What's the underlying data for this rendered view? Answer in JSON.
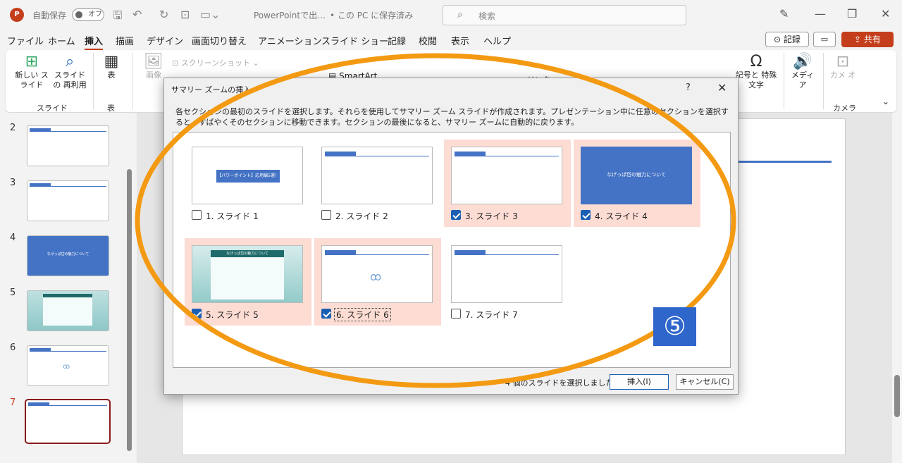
{
  "titlebar": {
    "autosave_label": "自動保存",
    "autosave_state": "オフ",
    "doc_title": "PowerPointで出…",
    "save_status": "• この PC に保存済み",
    "search_placeholder": "検索",
    "app_icon": "P"
  },
  "menu": {
    "tabs": [
      "ファイル",
      "ホーム",
      "挿入",
      "描画",
      "デザイン",
      "画面切り替え",
      "アニメーション",
      "スライド ショー",
      "記録",
      "校閲",
      "表示",
      "ヘルプ"
    ],
    "active_tab": "挿入",
    "record_label": "記録",
    "share_label": "共有"
  },
  "ribbon": {
    "new_slide": "新しい スライド",
    "reuse_slide": "スライドの 再利用",
    "table": "表",
    "images": "画像",
    "screenshot": "スクリーンショット",
    "smartart": "SmartArt",
    "symbols": "記号と 特殊文字",
    "media": "メディア",
    "camera": "カメラ",
    "camera_btn": "カメ オ",
    "group_slides": "スライド",
    "group_table": "表",
    "group_camera": "カメラ",
    "partial_link": "リンク"
  },
  "thumbnails": [
    {
      "num": "2"
    },
    {
      "num": "3"
    },
    {
      "num": "4",
      "caption": "なげっぱ岱の魅力について"
    },
    {
      "num": "5"
    },
    {
      "num": "6"
    },
    {
      "num": "7"
    }
  ],
  "dialog": {
    "title": "サマリー ズームの挿入",
    "help": "?",
    "description": "各セクションの最初のスライドを選択します。それらを使用してサマリー ズーム スライドが作成されます。プレゼンテーション中に任意のセクションを選択すると、すばやくそのセクションに移動できます。セクションの最後になると、サマリー ズームに自動的に戻ります。",
    "items": [
      {
        "label": "1. スライド 1",
        "checked": false,
        "preview_text": "【パワーポイント】応用編5選！"
      },
      {
        "label": "2. スライド 2",
        "checked": false
      },
      {
        "label": "3. スライド 3",
        "checked": true
      },
      {
        "label": "4. スライド 4",
        "checked": true,
        "preview_text": "なげっぱ岱の魅力について"
      },
      {
        "label": "5. スライド 5",
        "checked": true,
        "preview_text": "なげっぱ岱の魅力について"
      },
      {
        "label": "6. スライド 6",
        "checked": true
      },
      {
        "label": "7. スライド 7",
        "checked": false
      }
    ],
    "status": "4 個のスライドを選択しました",
    "insert_label": "挿入(I)",
    "cancel_label": "キャンセル(C)"
  },
  "annotation": {
    "badge": "⑤",
    "oval_color": "#f39a12"
  },
  "colors": {
    "accent": "#c43e1c",
    "selected_item": "#fcdcd3",
    "slide_blue": "#4472c4",
    "badge_blue": "#2f66cc"
  }
}
